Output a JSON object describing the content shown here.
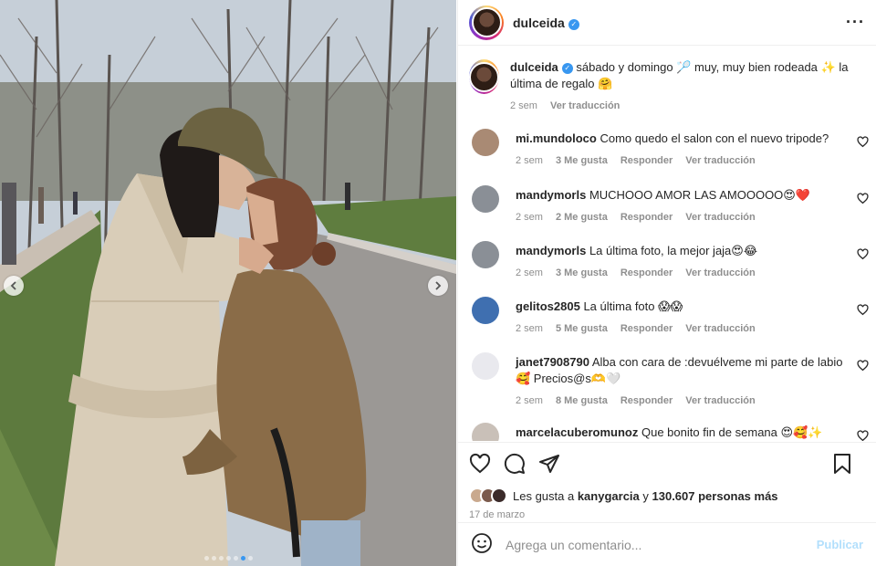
{
  "post": {
    "author": "dulceida",
    "verified_icon": "verified-badge-icon",
    "more_icon": "more-options-icon"
  },
  "caption": {
    "author": "dulceida",
    "text": "sábado y domingo 🏸 muy, muy bien rodeada ✨ la última de regalo 🤗",
    "age": "2 sem",
    "translate": "Ver traducción"
  },
  "comments": [
    {
      "user": "mi.mundoloco",
      "text": "Como quedo el salon con el nuevo tripode?",
      "age": "2 sem",
      "likes": "3 Me gusta",
      "reply": "Responder",
      "translate": "Ver traducción",
      "avatar_color": "#a98a74"
    },
    {
      "user": "mandymorls",
      "text": "MUCHOOO AMOR LAS AMOOOOO😍❤️",
      "age": "2 sem",
      "likes": "2 Me gusta",
      "reply": "Responder",
      "translate": "Ver traducción",
      "avatar_color": "#8a8f96"
    },
    {
      "user": "mandymorls",
      "text": "La última foto, la mejor jaja😍😂",
      "age": "2 sem",
      "likes": "3 Me gusta",
      "reply": "Responder",
      "translate": "Ver traducción",
      "avatar_color": "#8a8f96"
    },
    {
      "user": "gelitos2805",
      "text": "La última foto 😱😱",
      "age": "2 sem",
      "likes": "5 Me gusta",
      "reply": "Responder",
      "translate": "Ver traducción",
      "avatar_color": "#3f6fb0"
    },
    {
      "user": "janet7908790",
      "text": "Alba con cara de :devuélveme mi parte de labio 🥰 Precios@s🫶🤍",
      "age": "2 sem",
      "likes": "8 Me gusta",
      "reply": "Responder",
      "translate": "Ver traducción",
      "avatar_color": "#e9e9ee"
    },
    {
      "user": "marcelacuberomunoz",
      "text": "Que bonito fin de semana 😍🥰✨",
      "age": "",
      "likes": "",
      "reply": "",
      "translate": "",
      "avatar_color": "#c9c0b8"
    }
  ],
  "actions": {
    "like_icon": "heart-icon",
    "comment_icon": "comment-icon",
    "share_icon": "share-icon",
    "save_icon": "bookmark-icon"
  },
  "likes": {
    "prefix": "Les gusta a ",
    "user": "kanygarcia",
    "middle": " y ",
    "count": "130.607 personas más"
  },
  "date": "17 de marzo",
  "add_comment": {
    "placeholder": "Agrega un comentario...",
    "publish": "Publicar",
    "emoji_icon": "emoji-icon"
  },
  "carousel": {
    "prev_icon": "chevron-left-icon",
    "next_icon": "chevron-right-icon",
    "slide_count": 7,
    "active_index": 5
  },
  "colors": {
    "verified": "#3897f0",
    "publish_disabled": "#b2dffc",
    "meta_text": "#8e8e8e"
  }
}
